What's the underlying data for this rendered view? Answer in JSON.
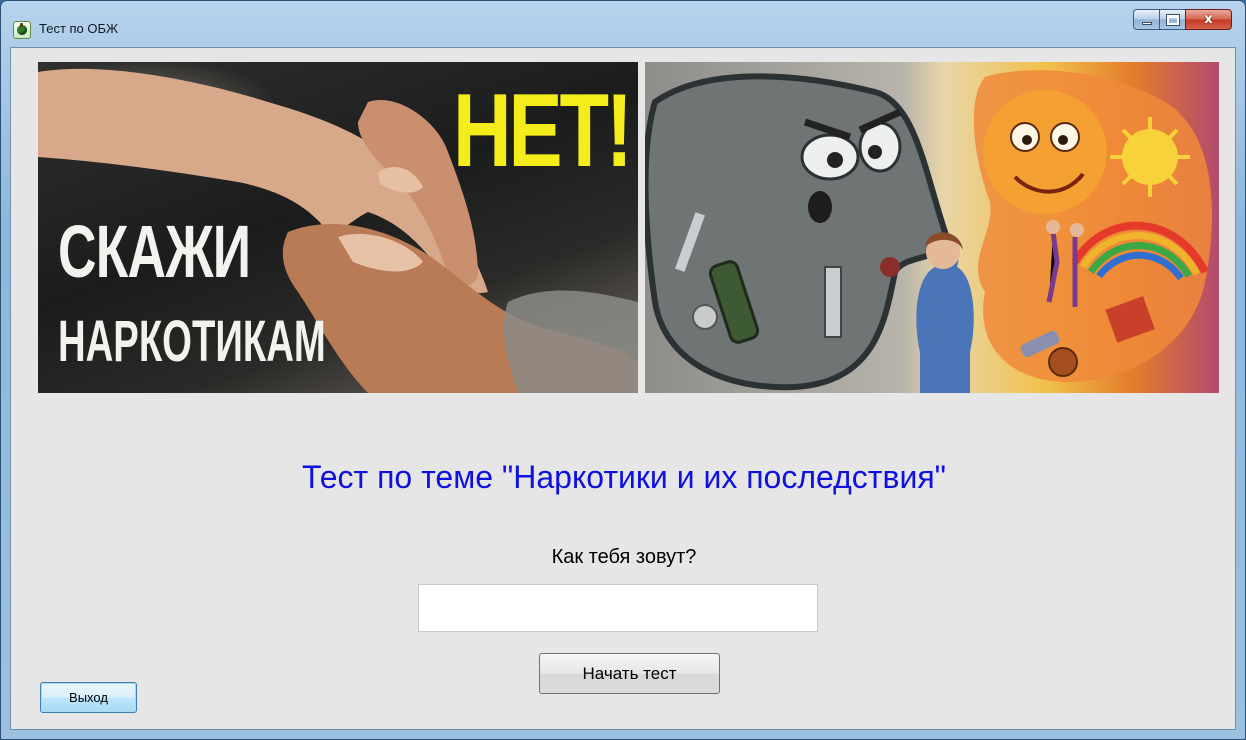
{
  "window": {
    "title": "Тест по ОБЖ",
    "icon": "apple-app-icon",
    "caption_buttons": [
      "minimize-icon",
      "maximize-icon",
      "close-icon"
    ],
    "close_glyph": "x"
  },
  "banner_left": {
    "text_no": "НЕТ!",
    "text_say": "СКАЖИ",
    "text_drugs": "НАРКОТИКАМ",
    "accent_color": "#f4ec1b"
  },
  "banner_right": {
    "description_icon": "drugs-vs-healthy-life-illustration"
  },
  "main": {
    "heading": "Тест по теме \"Наркотики  и их последствия\"",
    "heading_color": "#1010e0",
    "prompt": "Как тебя зовут?",
    "name_value": "",
    "start_button": "Начать тест",
    "exit_button": "Выход"
  }
}
